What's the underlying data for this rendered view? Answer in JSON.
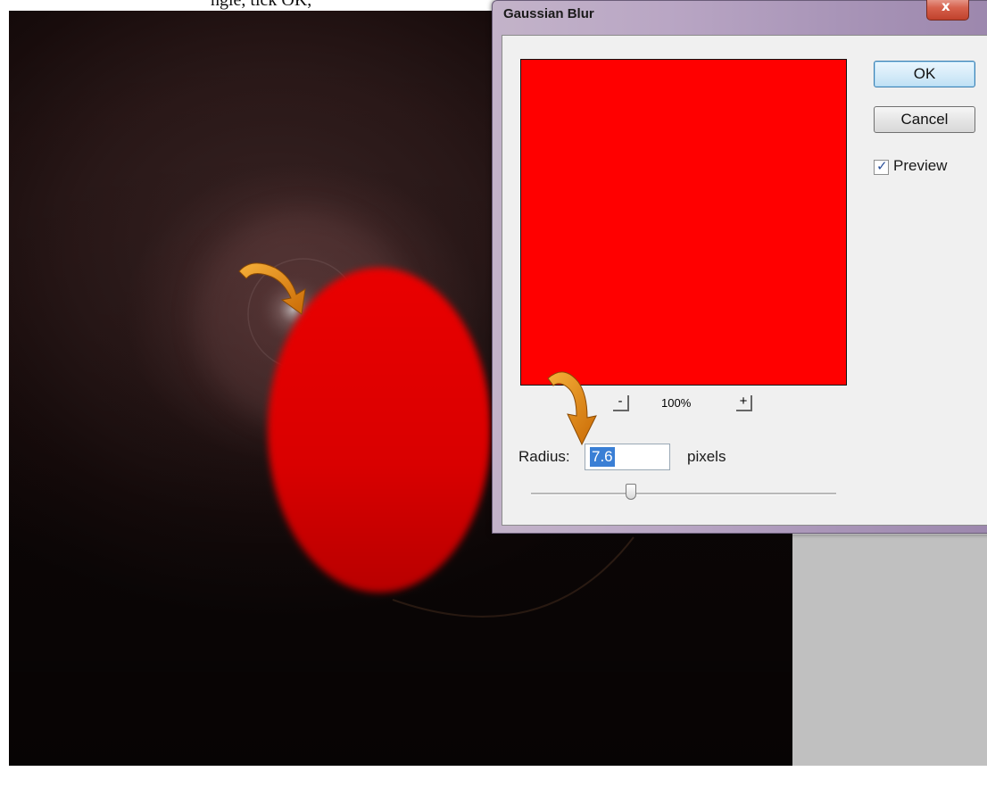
{
  "document": {
    "caption_fragment": "ngle, tick OK,"
  },
  "dialog": {
    "title": "Gaussian Blur",
    "close_glyph": "x",
    "buttons": {
      "ok": "OK",
      "cancel": "Cancel"
    },
    "preview": {
      "label": "Preview",
      "checked": true,
      "check_glyph": "✓"
    },
    "zoom": {
      "minus": "-",
      "level": "100%",
      "plus": "+"
    },
    "radius": {
      "label": "Radius:",
      "value": "7.6",
      "unit": "pixels"
    },
    "slider": {
      "value": 7.6
    }
  },
  "colors": {
    "preview_fill": "#ff0000",
    "blob_fill": "#ff0000",
    "arrow": "#e08a10",
    "selection": "#3a7fd5"
  },
  "icons": {
    "annotation_arrow": "curved-arrow-icon"
  }
}
